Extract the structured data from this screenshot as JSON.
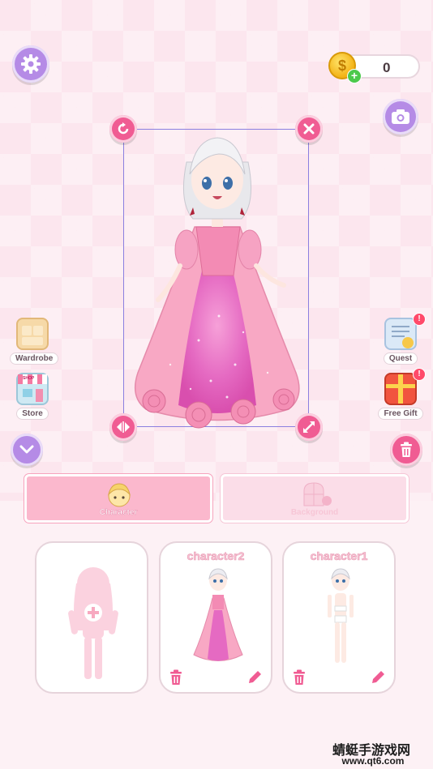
{
  "coins": {
    "value": "0",
    "coin_symbol": "$"
  },
  "left_menu": [
    {
      "label": "Wardrobe",
      "icon": "wardrobe-icon"
    },
    {
      "label": "Store",
      "icon": "store-icon"
    }
  ],
  "right_menu": [
    {
      "label": "Quest",
      "icon": "quest-icon",
      "badge": "!"
    },
    {
      "label": "Free Gift",
      "icon": "gift-icon",
      "badge": "!"
    }
  ],
  "tabs": [
    {
      "label": "Character",
      "active": true
    },
    {
      "label": "Background",
      "active": false
    }
  ],
  "cards": [
    {
      "title": "",
      "type": "add-character"
    },
    {
      "title": "character2",
      "type": "saved"
    },
    {
      "title": "character1",
      "type": "saved"
    }
  ],
  "store_sign": "SHOP",
  "watermark": {
    "line1": "蜻蜓手游戏网",
    "line2": "www.qt6.com"
  },
  "colors": {
    "accent_pink": "#f05c93",
    "accent_purple": "#b58be6",
    "selection": "#8b7fe0"
  }
}
